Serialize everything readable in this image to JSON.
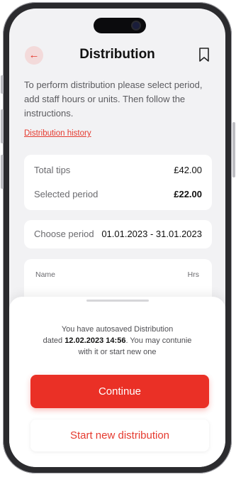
{
  "header": {
    "title": "Distribution",
    "back_icon": "arrow-left-icon",
    "bookmark_icon": "bookmark-icon"
  },
  "intro": "To perform distribution please select period, add staff hours or units. Then follow the instructions.",
  "history_link": "Distribution history",
  "totals": {
    "total_tips_label": "Total tips",
    "total_tips_value": "£42.00",
    "selected_period_label": "Selected period",
    "selected_period_value": "£22.00"
  },
  "period": {
    "label": "Choose period",
    "value": "01.01.2023 - 31.01.2023"
  },
  "table": {
    "col_name": "Name",
    "col_hrs": "Hrs"
  },
  "sheet": {
    "msg_line1": "You have autosaved Distribution",
    "msg_dated": "dated ",
    "msg_date": "12.02.2023 14:56",
    "msg_rest": ". You may contunie with it or start new one",
    "continue_label": "Continue",
    "new_label": "Start new distribution"
  },
  "colors": {
    "accent": "#ea3026",
    "background": "#f2f2f4"
  }
}
